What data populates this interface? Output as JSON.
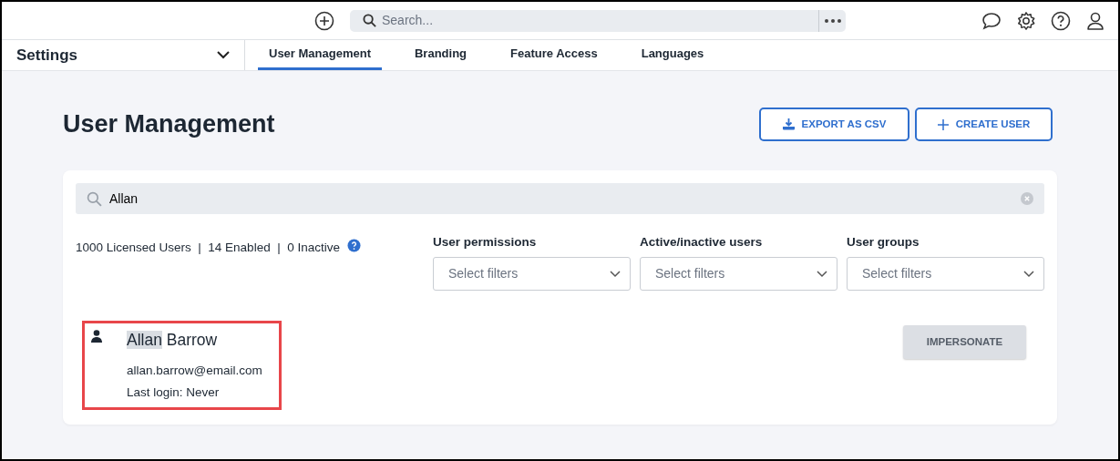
{
  "top_bar": {
    "search": {
      "placeholder": "Search..."
    }
  },
  "settings_menu": {
    "label": "Settings"
  },
  "tabs": [
    {
      "label": "User Management",
      "selected": true
    },
    {
      "label": "Branding",
      "selected": false
    },
    {
      "label": "Feature Access",
      "selected": false
    },
    {
      "label": "Languages",
      "selected": false
    }
  ],
  "page": {
    "title": "User Management",
    "buttons": [
      {
        "kind": "export",
        "label": "EXPORT AS CSV"
      },
      {
        "kind": "create",
        "label": "CREATE USER"
      }
    ]
  },
  "user_search": {
    "value": "Allan"
  },
  "stats": "1000 Licensed Users  |  14 Enabled  |  0 Inactive",
  "filters": [
    {
      "label": "User permissions",
      "placeholder": "Select filters"
    },
    {
      "label": "Active/inactive users",
      "placeholder": "Select filters"
    },
    {
      "label": "User groups",
      "placeholder": "Select filters"
    }
  ],
  "users": [
    {
      "name_match": "Allan",
      "name_rest": "Barrow",
      "email": "allan.barrow@email.com",
      "last_login": "Last login: Never",
      "annotated": true,
      "action": "IMPERSONATE"
    }
  ]
}
